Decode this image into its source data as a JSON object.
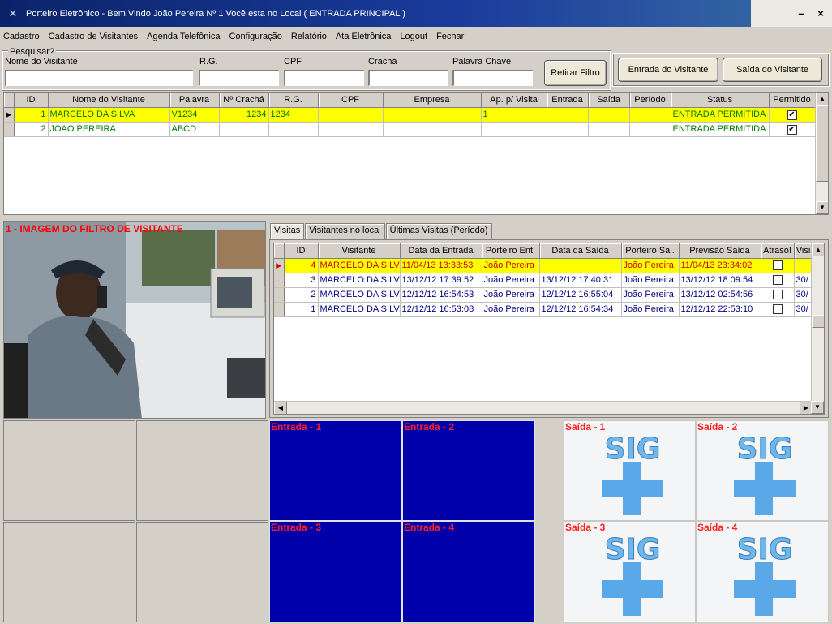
{
  "window": {
    "title": "Porteiro Eletrônico - Bem Vindo João Pereira Nº 1 Você esta no Local ( ENTRADA PRINCIPAL )",
    "minimize": "–",
    "close": "×"
  },
  "menu": [
    "Cadastro",
    "Cadastro de Visitantes",
    "Agenda Telefônica",
    "Configuração",
    "Relatório",
    "Ata Eletrônica",
    "Logout",
    "Fechar"
  ],
  "filter": {
    "legend": "Pesquisar?",
    "fields": [
      "Nome do Visitante",
      "R.G.",
      "CPF",
      "Crachá",
      "Palavra Chave"
    ],
    "clear_button": "Retirar Filtro",
    "entry_button": "Entrada do Visitante",
    "exit_button": "Saída do Visitante"
  },
  "visitors_grid": {
    "columns": [
      "ID",
      "Nome do Visitante",
      "Palavra",
      "Nº Crachá",
      "R.G.",
      "CPF",
      "Empresa",
      "Ap. p/ Visita",
      "Entrada",
      "Saída",
      "Período",
      "Status",
      "Permitido"
    ],
    "rows": [
      {
        "id": "1",
        "name": "MARCELO DA SILVA",
        "palavra": "V1234",
        "cracha": "1234",
        "rg": "1234",
        "cpf": "",
        "empresa": "",
        "ap": "1",
        "entrada": "",
        "saida": "",
        "periodo": "",
        "status": "ENTRADA PERMITIDA",
        "permitido": true,
        "selected": true
      },
      {
        "id": "2",
        "name": "JOAO PEREIRA",
        "palavra": "ABCD",
        "cracha": "",
        "rg": "",
        "cpf": "",
        "empresa": "",
        "ap": "",
        "entrada": "",
        "saida": "",
        "periodo": "",
        "status": "ENTRADA PERMITIDA",
        "permitido": true,
        "selected": false
      }
    ]
  },
  "photo": {
    "label": "1 - IMAGEM DO FILTRO DE VISITANTE"
  },
  "tabs": [
    "Visitas",
    "Visitantes no local",
    "Últimas Visitas (Período)"
  ],
  "visits_grid": {
    "columns": [
      "ID",
      "Visitante",
      "Data da Entrada",
      "Porteiro Ent.",
      "Data da Saída",
      "Porteiro Sai.",
      "Previsão Saída",
      "Atraso!",
      "Visi"
    ],
    "rows": [
      {
        "id": "4",
        "visitante": "MARCELO DA SILV/",
        "entrada": "11/04/13 13:33:53",
        "porteiro_ent": "João Pereira",
        "saida": "",
        "porteiro_sai": "João Pereira",
        "previsao": "11/04/13 23:34:02",
        "visi": "",
        "selected": true
      },
      {
        "id": "3",
        "visitante": "MARCELO DA SILV/",
        "entrada": "13/12/12 17:39:52",
        "porteiro_ent": "João Pereira",
        "saida": "13/12/12 17:40:31",
        "porteiro_sai": "João Pereira",
        "previsao": "13/12/12 18:09:54",
        "visi": "30/",
        "selected": false
      },
      {
        "id": "2",
        "visitante": "MARCELO DA SILV/",
        "entrada": "12/12/12 16:54:53",
        "porteiro_ent": "João Pereira",
        "saida": "12/12/12 16:55:04",
        "porteiro_sai": "João Pereira",
        "previsao": "13/12/12 02:54:56",
        "visi": "30/",
        "selected": false
      },
      {
        "id": "1",
        "visitante": "MARCELO DA SILV/",
        "entrada": "12/12/12 16:53:08",
        "porteiro_ent": "João Pereira",
        "saida": "12/12/12 16:54:34",
        "porteiro_sai": "João Pereira",
        "previsao": "12/12/12 22:53:10",
        "visi": "30/",
        "selected": false
      }
    ]
  },
  "cameras": {
    "entrada": [
      "Entrada - 1",
      "Entrada - 2",
      "Entrada - 3",
      "Entrada - 4"
    ],
    "saida": [
      "Saída - 1",
      "Saída - 2",
      "Saída - 3",
      "Saída - 4"
    ],
    "logo_text": "SIG"
  }
}
